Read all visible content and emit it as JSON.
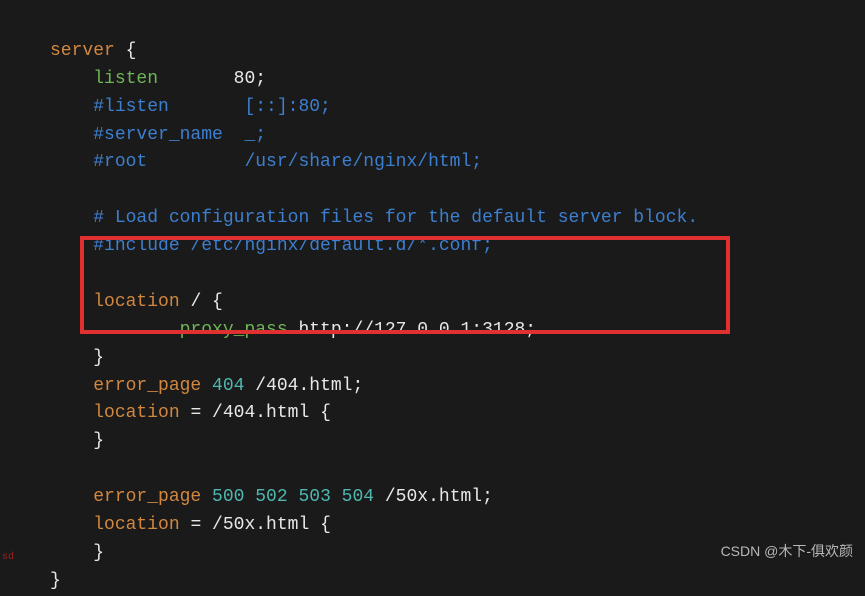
{
  "code": {
    "l1_kw": "server",
    "l1_brace": " {",
    "l2_kw": "listen",
    "l2_val": "       80;",
    "l3": "#listen       [::]:80;",
    "l4": "#server_name  _;",
    "l5": "#root         /usr/share/nginx/html;",
    "l6": "# Load configuration files for the default server block.",
    "l7": "#include /etc/nginx/default.d/*.conf;",
    "l8_kw": "location",
    "l8_rest": " / {",
    "l9_kw": "proxy_pass",
    "l9_val": " http://127.0.0.1:3128;",
    "l10": "}",
    "l11_kw": "error_page",
    "l11_num": " 404",
    "l11_path": " /404.html;",
    "l12_kw": "location",
    "l12_eq": " = ",
    "l12_path": "/404.html",
    "l12_brace": " {",
    "l13": "}",
    "l14_kw": "error_page",
    "l14_num": " 500 502 503 504",
    "l14_path": " /50x.html;",
    "l15_kw": "location",
    "l15_eq": " = ",
    "l15_path": "/50x.html",
    "l15_brace": " {",
    "l16": "}",
    "l17": "}"
  },
  "watermark": "CSDN @木下-俱欢颜",
  "tiny_marker": "sd"
}
